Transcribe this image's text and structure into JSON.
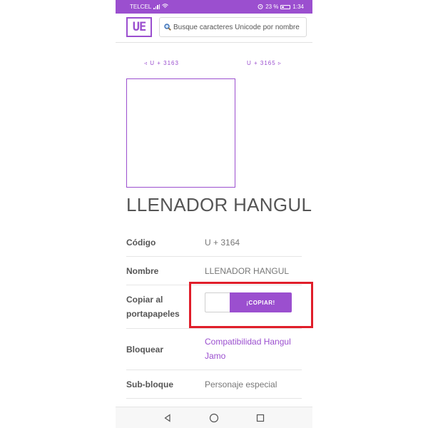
{
  "statusbar": {
    "carrier": "TELCEL",
    "battery": "23 %",
    "time": "1:34"
  },
  "appbar": {
    "logo": "UE",
    "search_placeholder": "Busque caracteres Unicode por nombre"
  },
  "navigation": {
    "prev": "◃ U + 3163",
    "next": "U + 3165 ▹"
  },
  "character": {
    "title": "LLENADOR HANGUL"
  },
  "details": {
    "code_label": "Código",
    "code_value": "U + 3164",
    "name_label": "Nombre",
    "name_value": "LLENADOR HANGUL",
    "copy_label_line1": "Copiar al",
    "copy_label_line2": "portapapeles",
    "copy_button": "¡COPIAR!",
    "block_label": "Bloquear",
    "block_value_line1": "Compatibilidad Hangul",
    "block_value_line2": "Jamo",
    "subblock_label": "Sub-bloque",
    "subblock_value": "Personaje especial"
  },
  "colors": {
    "accent": "#9b4fcf",
    "highlight": "#e01e2a"
  },
  "icons": {
    "search": "search-icon",
    "back": "back-triangle-icon",
    "home": "home-circle-icon",
    "recents": "recents-square-icon"
  }
}
